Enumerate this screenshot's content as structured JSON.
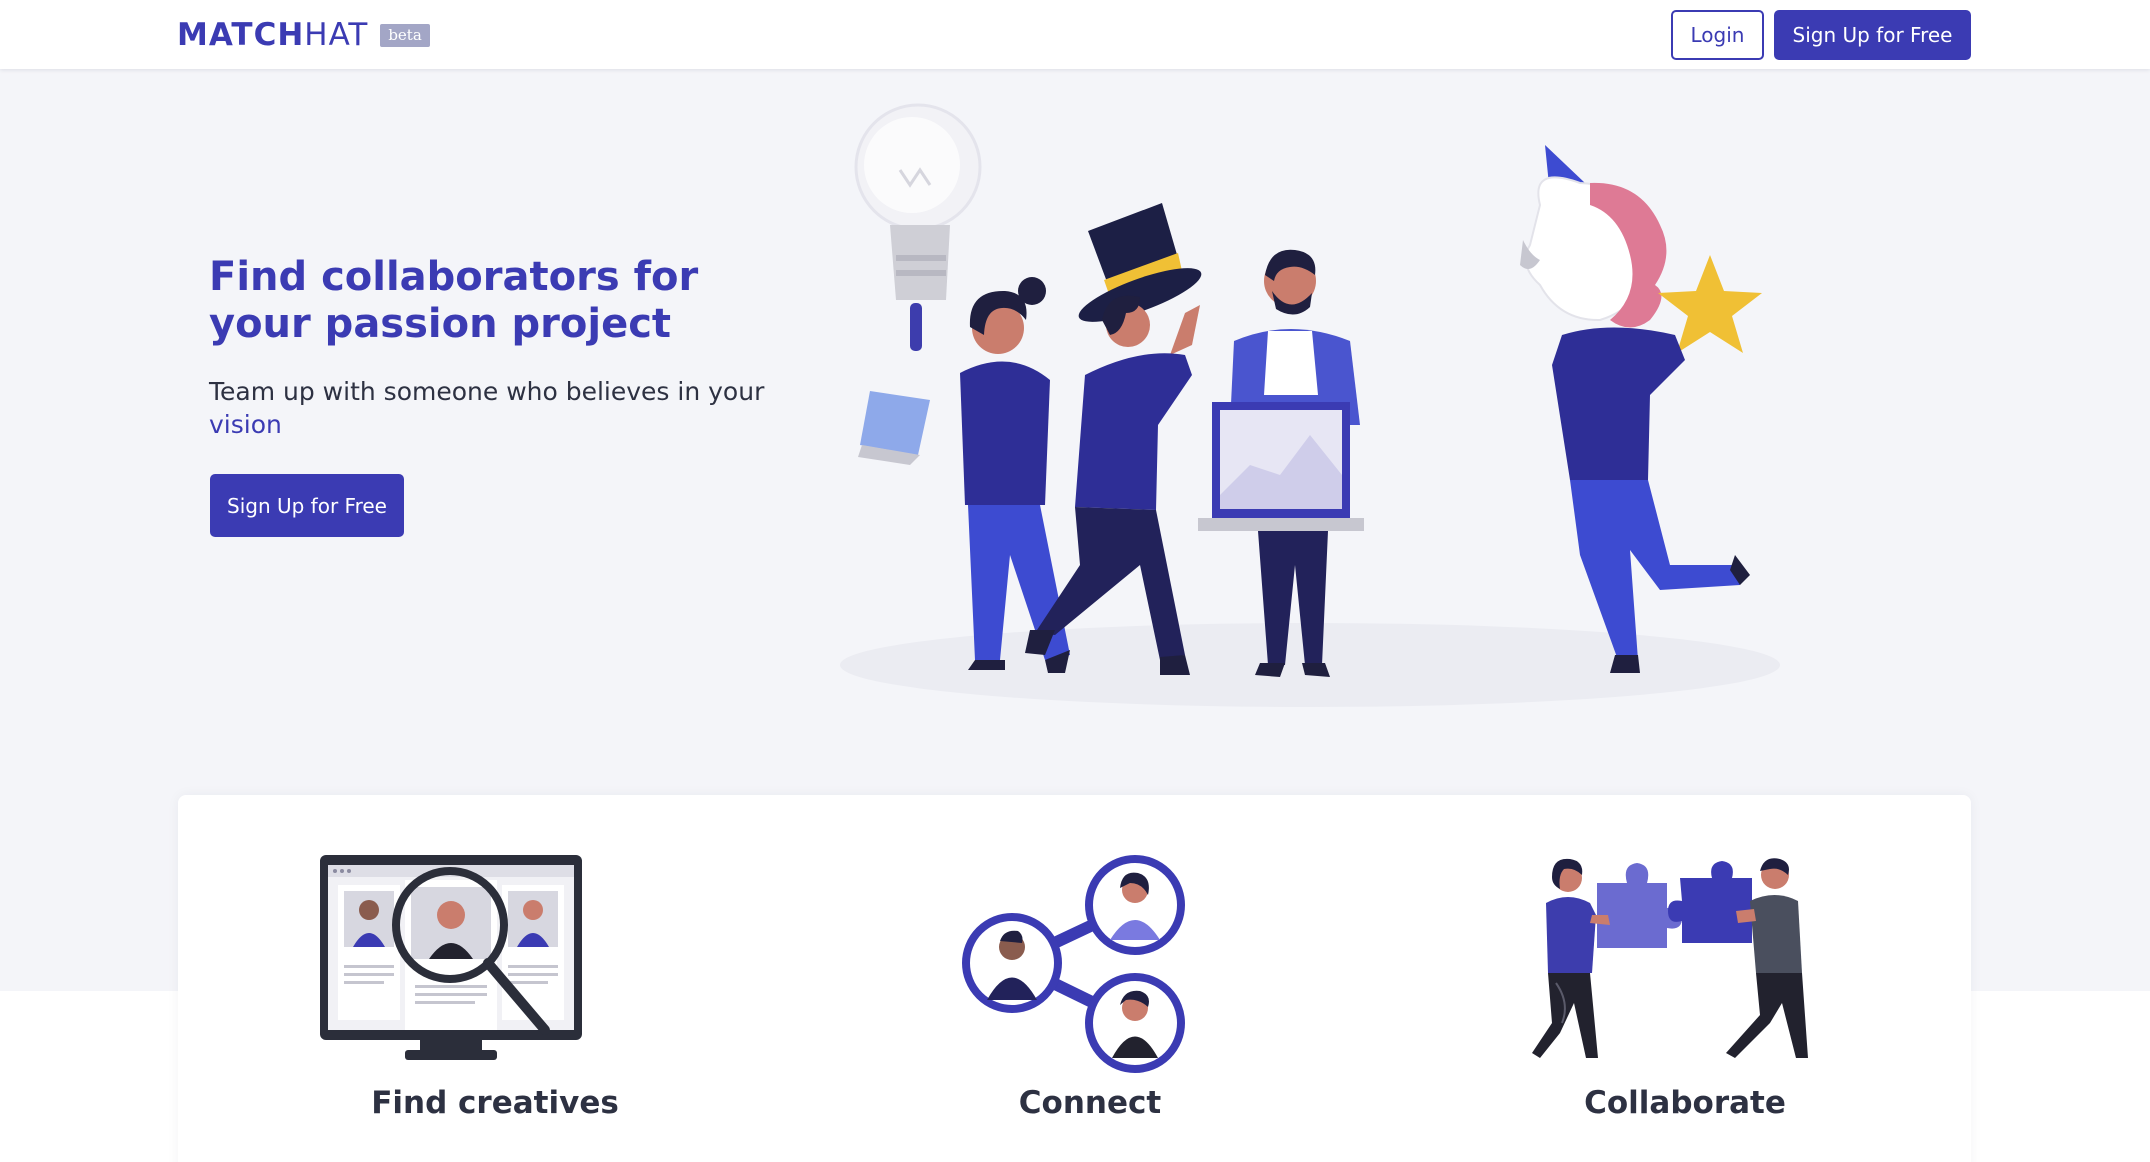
{
  "header": {
    "logo_primary": "MATCH",
    "logo_secondary": "HAT",
    "beta_badge": "beta",
    "login_label": "Login",
    "signup_label": "Sign Up for Free"
  },
  "hero": {
    "title_line1": "Find collaborators for",
    "title_line2": "your passion project",
    "subtitle_main": "Team up with someone who believes in your",
    "subtitle_accent": "vision",
    "cta_label": "Sign Up for Free",
    "illustration": "team-celebrating-illustration"
  },
  "features": [
    {
      "label": "Find creatives",
      "icon": "profile-search-icon"
    },
    {
      "label": "Connect",
      "icon": "network-connect-icon"
    },
    {
      "label": "Collaborate",
      "icon": "puzzle-collaborate-icon"
    }
  ],
  "colors": {
    "brand": "#3b3bb3",
    "hero_bg": "#f4f5f9",
    "text": "#2d3142",
    "beta_bg": "#a3a6c6"
  }
}
